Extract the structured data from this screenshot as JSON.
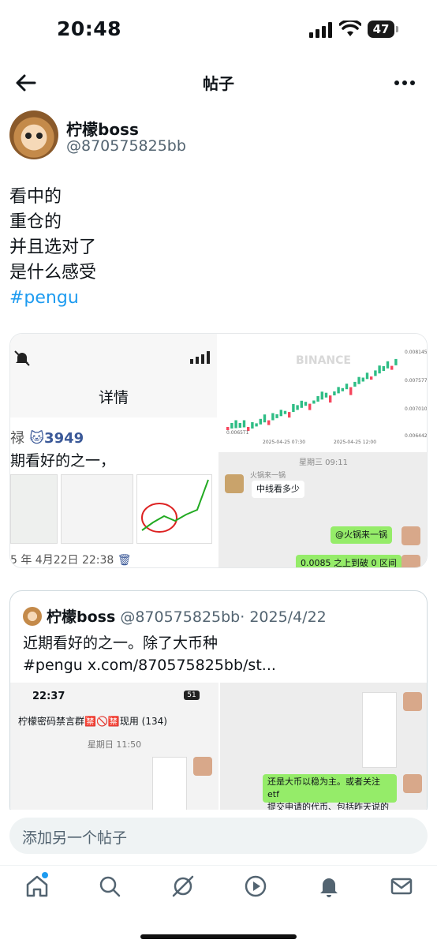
{
  "status": {
    "time": "20:48",
    "battery": "47"
  },
  "nav": {
    "title": "帖子"
  },
  "post": {
    "author_name": "柠檬boss",
    "author_handle": "@870575825bb",
    "lines": [
      "看中的",
      "重仓的",
      "并且选对了",
      "是什么感受"
    ],
    "hashtag": "#pengu"
  },
  "media": {
    "left": {
      "detail_label": "详情",
      "count": "🐱3949",
      "count_prefix": "禄",
      "text": "期看好的之一，",
      "date": "5 年 4月22日 22:38"
    },
    "chart": {
      "watermark": "BINANCE",
      "price_labels": [
        "0.008145",
        "0.007577",
        "0.007010",
        "0.006442"
      ],
      "low_label": "0.0065T1",
      "time_labels": [
        "2025-04-25 07:30",
        "2025-04-25 12:00"
      ]
    },
    "chat": {
      "day": "星期三 09:11",
      "sender": "火锅来一锅",
      "msg1": "中线看多少",
      "msg2": "@火锅来一锅",
      "msg3": "0.0085 之上到破 0 区间",
      "sender2": "火锅来一锅"
    }
  },
  "quote": {
    "name": "柠檬boss",
    "handle": "@870575825bb",
    "date": "· 2025/4/22",
    "text1": "近期看好的之一。除了大币种",
    "text2": "#pengu x.com/870575825bb/st...",
    "img1": {
      "time": "22:37",
      "battery": "51",
      "title": "柠檬密码禁言群🈲🚫🈲现用 (134)",
      "day": "星期日 11:50"
    },
    "img2": {
      "msg": "还是大币以稳为主。或者关注 etf",
      "msg2": "提交申请的代币、包括昨天说的"
    }
  },
  "compose": {
    "placeholder": "添加另一个帖子"
  },
  "tabs": [
    "home-icon",
    "search-icon",
    "grok-icon",
    "video-icon",
    "bell-icon",
    "mail-icon"
  ]
}
